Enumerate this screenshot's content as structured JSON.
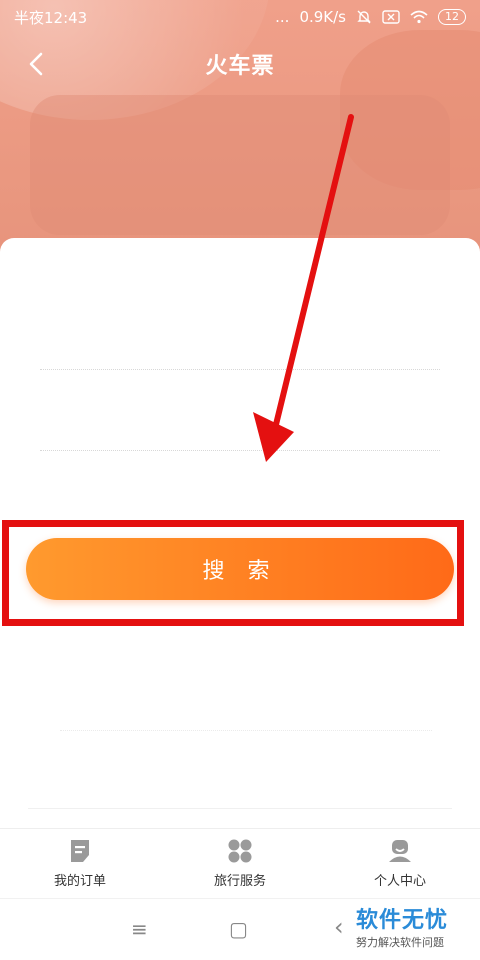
{
  "status_bar": {
    "time": "半夜12:43",
    "network_speed": "0.9K/s",
    "battery": "12",
    "dots": "..."
  },
  "nav": {
    "title": "火车票",
    "back_icon": "chevron-left-icon"
  },
  "search": {
    "label": "搜 索"
  },
  "tabs": [
    {
      "label": "我的订单",
      "icon": "order-icon"
    },
    {
      "label": "旅行服务",
      "icon": "grid-icon"
    },
    {
      "label": "个人中心",
      "icon": "user-icon"
    }
  ],
  "system_nav": {
    "menu_icon": "≡",
    "home_icon": "▢",
    "back_icon": "‹"
  },
  "watermark": {
    "title": "软件无忧",
    "subtitle": "努力解决软件问题"
  },
  "colors": {
    "header": "#ec9a84",
    "search_button_start": "#ff9a2e",
    "search_button_end": "#ff6a18",
    "annotation_red": "#e41010",
    "watermark_blue": "#2a8bd8"
  }
}
